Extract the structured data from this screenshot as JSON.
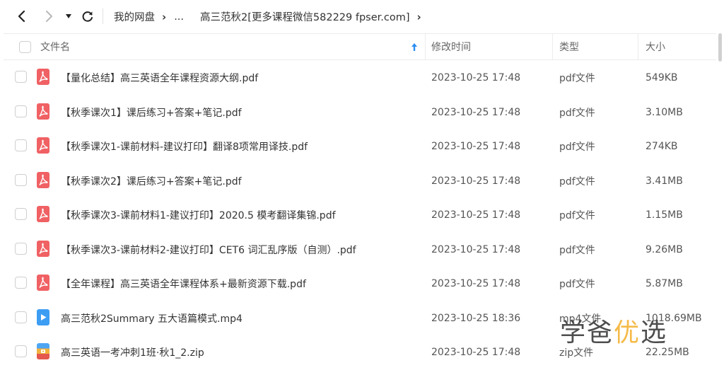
{
  "nav": {
    "back_icon": "chevron-left-icon",
    "forward_icon": "chevron-right-icon",
    "dropdown_icon": "caret-down-icon",
    "refresh_icon": "refresh-icon"
  },
  "breadcrumb": [
    {
      "label": "我的网盘"
    },
    {
      "label": "..."
    },
    {
      "label": "高三范秋2[更多课程微信582229 fpser.com]"
    }
  ],
  "table": {
    "columns": {
      "name": "文件名",
      "modified": "修改时间",
      "type": "类型",
      "size": "大小"
    },
    "sort_icon": "arrow-up-icon",
    "rows": [
      {
        "name": "【量化总结】高三英语全年课程资源大纲.pdf",
        "modified": "2023-10-25 17:48",
        "type": "pdf文件",
        "size": "549KB",
        "icon": "pdf-icon"
      },
      {
        "name": "【秋季课次1】课后练习+答案+笔记.pdf",
        "modified": "2023-10-25 17:48",
        "type": "pdf文件",
        "size": "3.10MB",
        "icon": "pdf-icon"
      },
      {
        "name": "【秋季课次1-课前材料-建议打印】翻译8项常用译技.pdf",
        "modified": "2023-10-25 17:48",
        "type": "pdf文件",
        "size": "274KB",
        "icon": "pdf-icon"
      },
      {
        "name": "【秋季课次2】课后练习+答案+笔记.pdf",
        "modified": "2023-10-25 17:48",
        "type": "pdf文件",
        "size": "3.41MB",
        "icon": "pdf-icon"
      },
      {
        "name": "【秋季课次3-课前材料1-建议打印】2020.5 模考翻译集锦.pdf",
        "modified": "2023-10-25 17:48",
        "type": "pdf文件",
        "size": "1.15MB",
        "icon": "pdf-icon"
      },
      {
        "name": "【秋季课次3-课前材料2-建议打印】CET6 词汇乱序版（自测）.pdf",
        "modified": "2023-10-25 17:48",
        "type": "pdf文件",
        "size": "9.26MB",
        "icon": "pdf-icon"
      },
      {
        "name": "【全年课程】高三英语全年课程体系+最新资源下载.pdf",
        "modified": "2023-10-25 17:48",
        "type": "pdf文件",
        "size": "5.87MB",
        "icon": "pdf-icon"
      },
      {
        "name": "高三范秋2Summary 五大语篇模式.mp4",
        "modified": "2023-10-25 18:36",
        "type": "mp4文件",
        "size": "1018.69MB",
        "icon": "video-file-icon"
      },
      {
        "name": "高三英语一考冲刺1班·秋1_2.zip",
        "modified": "2023-10-25 17:48",
        "type": "zip文件",
        "size": "22.25MB",
        "icon": "zip-file-icon"
      }
    ]
  },
  "watermark": {
    "part1": "学爸",
    "part2": "优",
    "part3": "选"
  },
  "colors": {
    "pdf": "#f06164",
    "video": "#3d9df3",
    "sort_arrow": "#2b8ef0",
    "watermark_accent": "#f5b335"
  }
}
